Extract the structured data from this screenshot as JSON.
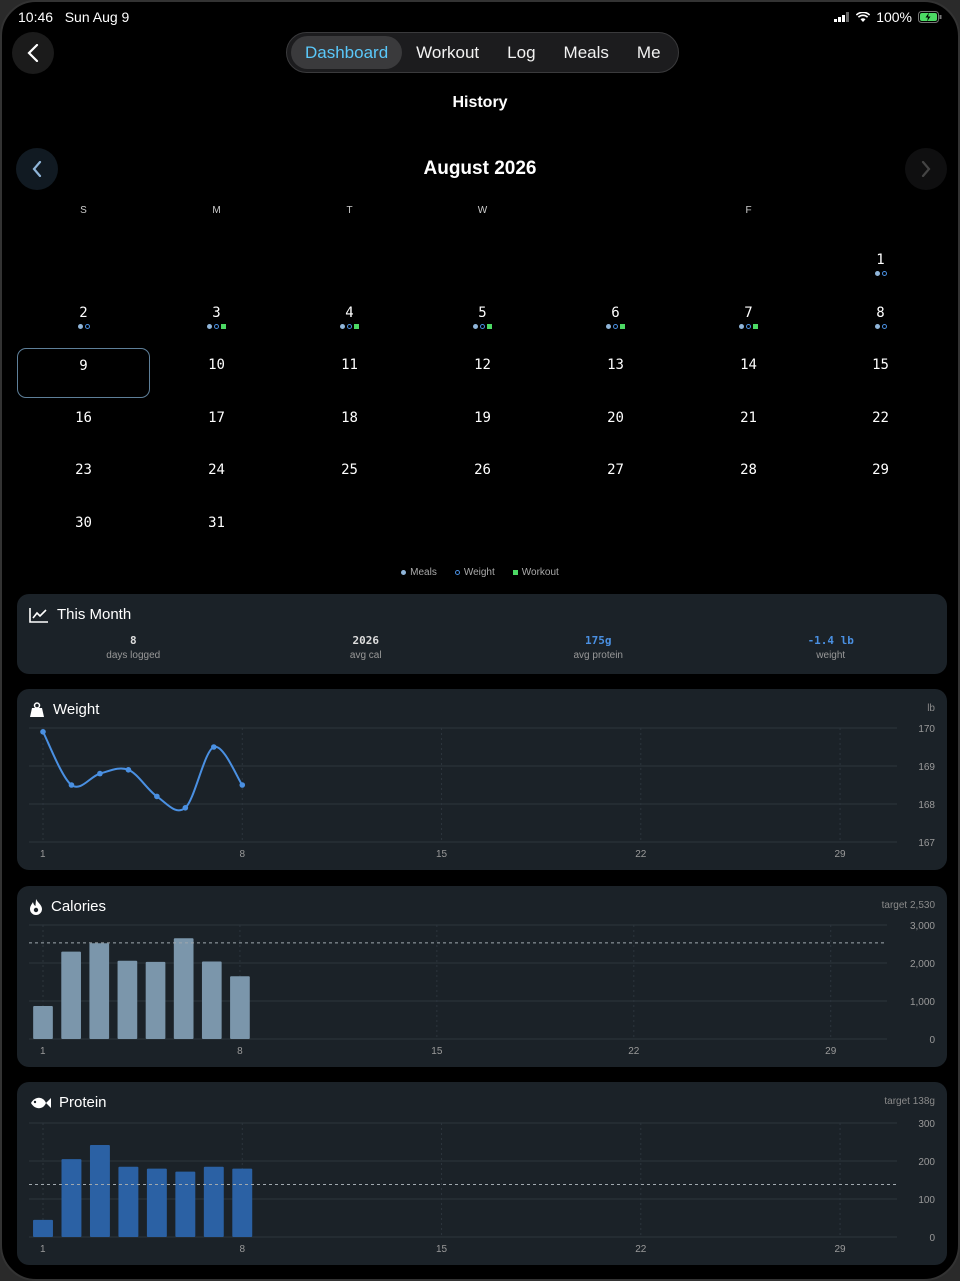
{
  "status": {
    "time": "10:46",
    "date": "Sun Aug 9",
    "battery": "100%"
  },
  "nav": {
    "tabs": [
      "Dashboard",
      "Workout",
      "Log",
      "Meals",
      "Me"
    ],
    "active": 0
  },
  "page_title": "History",
  "calendar": {
    "month_title": "August 2026",
    "weekdays": [
      "S",
      "M",
      "T",
      "W",
      "",
      "F",
      ""
    ],
    "first_weekday_offset": 6,
    "days_in_month": 31,
    "today": 9,
    "markers": {
      "1": [
        "meal",
        "weight"
      ],
      "2": [
        "meal",
        "weight"
      ],
      "3": [
        "meal",
        "weight",
        "workout"
      ],
      "4": [
        "meal",
        "weight",
        "workout"
      ],
      "5": [
        "meal",
        "weight",
        "workout"
      ],
      "6": [
        "meal",
        "weight",
        "workout"
      ],
      "7": [
        "meal",
        "weight",
        "workout"
      ],
      "8": [
        "meal",
        "weight"
      ]
    },
    "legend": {
      "meals": "Meals",
      "weight": "Weight",
      "workout": "Workout"
    }
  },
  "this_month": {
    "title": "This Month",
    "stats": [
      {
        "value": "8",
        "label": "days logged",
        "color": "#dddddd"
      },
      {
        "value": "2026",
        "label": "avg cal",
        "color": "#dddddd"
      },
      {
        "value": "175g",
        "label": "avg protein",
        "color": "#4a90e2"
      },
      {
        "value": "-1.4 lb",
        "label": "weight",
        "color": "#4a90e2"
      }
    ]
  },
  "weight_card": {
    "title": "Weight",
    "unit": "lb"
  },
  "calories_card": {
    "title": "Calories",
    "target_label": "target 2,530"
  },
  "protein_card": {
    "title": "Protein",
    "target_label": "target 138g"
  },
  "chart_data": [
    {
      "type": "line",
      "title": "Weight",
      "x": [
        1,
        2,
        3,
        4,
        5,
        6,
        7,
        8
      ],
      "values": [
        169.9,
        168.5,
        168.8,
        168.9,
        168.2,
        167.9,
        169.5,
        168.5
      ],
      "ylim": [
        167,
        170
      ],
      "yticks": [
        170,
        169,
        168,
        167
      ],
      "xticks": [
        1,
        8,
        15,
        22,
        29
      ],
      "xlim": [
        1,
        31
      ],
      "color": "#4a90e2"
    },
    {
      "type": "bar",
      "title": "Calories",
      "x": [
        1,
        2,
        3,
        4,
        5,
        6,
        7,
        8
      ],
      "values": [
        870,
        2300,
        2520,
        2060,
        2030,
        2650,
        2040,
        1650
      ],
      "target": 2530,
      "ylim": [
        0,
        3000
      ],
      "yticks": [
        3000,
        2000,
        1000,
        0
      ],
      "ytick_labels": [
        "3,000",
        "2,000",
        "1,000",
        "0"
      ],
      "xticks": [
        1,
        8,
        15,
        22,
        29
      ],
      "xlim": [
        1,
        31
      ],
      "color": "#7b96ab"
    },
    {
      "type": "bar",
      "title": "Protein",
      "x": [
        1,
        2,
        3,
        4,
        5,
        6,
        7,
        8
      ],
      "values": [
        45,
        205,
        242,
        185,
        180,
        172,
        185,
        180
      ],
      "target": 138,
      "ylim": [
        0,
        300
      ],
      "yticks": [
        300,
        200,
        100,
        0
      ],
      "ytick_labels": [
        "300",
        "200",
        "100",
        "0"
      ],
      "xticks": [
        1,
        8,
        15,
        22,
        29
      ],
      "xlim": [
        1,
        31
      ],
      "color": "#2b61a4"
    }
  ]
}
